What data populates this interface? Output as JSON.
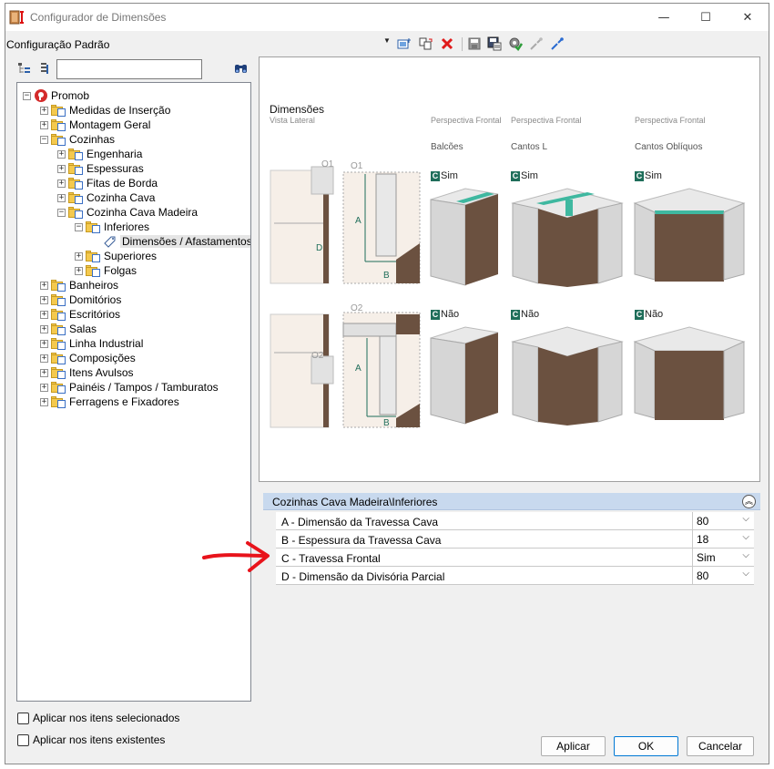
{
  "window": {
    "title": "Configurador de Dimensões",
    "minimize_glyph": "—",
    "maximize_glyph": "☐",
    "close_glyph": "✕"
  },
  "config_bar": {
    "label": "Configuração Padrão",
    "dropdown_glyph": "▼",
    "toolbar_icons": [
      "new-item-icon",
      "copy-item-icon",
      "delete-icon",
      "save-icon",
      "save-as-icon",
      "apply-settings-icon",
      "collapse-link-icon",
      "expand-link-icon"
    ]
  },
  "tree": {
    "search_placeholder": "",
    "items": [
      {
        "label": "Promob",
        "level": 0,
        "expander": "−",
        "icon": "promob-logo-icon"
      },
      {
        "label": "Medidas de Inserção",
        "level": 1,
        "expander": "+",
        "icon": "folder-icon"
      },
      {
        "label": "Montagem Geral",
        "level": 1,
        "expander": "+",
        "icon": "folder-icon"
      },
      {
        "label": "Cozinhas",
        "level": 1,
        "expander": "−",
        "icon": "folder-icon"
      },
      {
        "label": "Engenharia",
        "level": 2,
        "expander": "+",
        "icon": "folder-icon"
      },
      {
        "label": "Espessuras",
        "level": 2,
        "expander": "+",
        "icon": "folder-icon"
      },
      {
        "label": "Fitas de Borda",
        "level": 2,
        "expander": "+",
        "icon": "folder-icon"
      },
      {
        "label": "Cozinha Cava",
        "level": 2,
        "expander": "+",
        "icon": "folder-icon"
      },
      {
        "label": "Cozinha Cava Madeira",
        "level": 2,
        "expander": "−",
        "icon": "folder-icon"
      },
      {
        "label": "Inferiores",
        "level": 3,
        "expander": "−",
        "icon": "folder-icon"
      },
      {
        "label": "Dimensões / Afastamentos",
        "level": 4,
        "expander": "",
        "icon": "tag-icon",
        "selected": true
      },
      {
        "label": "Superiores",
        "level": 3,
        "expander": "+",
        "icon": "folder-icon"
      },
      {
        "label": "Folgas",
        "level": 3,
        "expander": "+",
        "icon": "folder-icon"
      },
      {
        "label": "Banheiros",
        "level": 1,
        "expander": "+",
        "icon": "folder-icon"
      },
      {
        "label": "Domitórios",
        "level": 1,
        "expander": "+",
        "icon": "folder-icon"
      },
      {
        "label": "Escritórios",
        "level": 1,
        "expander": "+",
        "icon": "folder-icon"
      },
      {
        "label": "Salas",
        "level": 1,
        "expander": "+",
        "icon": "folder-icon"
      },
      {
        "label": "Linha Industrial",
        "level": 1,
        "expander": "+",
        "icon": "folder-icon"
      },
      {
        "label": "Composições",
        "level": 1,
        "expander": "+",
        "icon": "folder-icon"
      },
      {
        "label": "Itens Avulsos",
        "level": 1,
        "expander": "+",
        "icon": "folder-icon"
      },
      {
        "label": "Painéis / Tampos / Tamburatos",
        "level": 1,
        "expander": "+",
        "icon": "folder-icon"
      },
      {
        "label": "Ferragens e Fixadores",
        "level": 1,
        "expander": "+",
        "icon": "folder-icon"
      }
    ]
  },
  "preview": {
    "title": "Dimensões",
    "subtitle": "Vista Lateral",
    "perspective_label": "Perspectiva Frontal",
    "categories": [
      "Balcões",
      "Cantos L",
      "Cantos Oblíquos"
    ],
    "option_yes": "Sim",
    "option_no": "Não",
    "badge_letter": "C",
    "labels": {
      "o1": "O1",
      "o2": "O2",
      "a": "A",
      "b": "B",
      "d": "D"
    }
  },
  "properties": {
    "header": "Cozinhas Cava Madeira\\Inferiores",
    "collapse_glyph": "︽",
    "rows": [
      {
        "name": "A - Dimensão da Travessa Cava",
        "value": "80"
      },
      {
        "name": "B - Espessura da Travessa Cava",
        "value": "18"
      },
      {
        "name": "C - Travessa Frontal",
        "value": "Sim"
      },
      {
        "name": "D - Dimensão da Divisória Parcial",
        "value": "80"
      }
    ],
    "dropdown_glyph": "⌵"
  },
  "options": {
    "apply_selected": "Aplicar nos itens selecionados",
    "apply_existing": "Aplicar nos itens existentes"
  },
  "buttons": {
    "apply": "Aplicar",
    "ok": "OK",
    "cancel": "Cancelar"
  },
  "colors": {
    "accent_green": "#1f6e5a",
    "teal_highlight": "#3fb8a0",
    "wood": "#6b5140",
    "cabinet_grey": "#d6d6d6",
    "header_blue": "#c8d9ee",
    "annotation_red": "#e8131b"
  }
}
